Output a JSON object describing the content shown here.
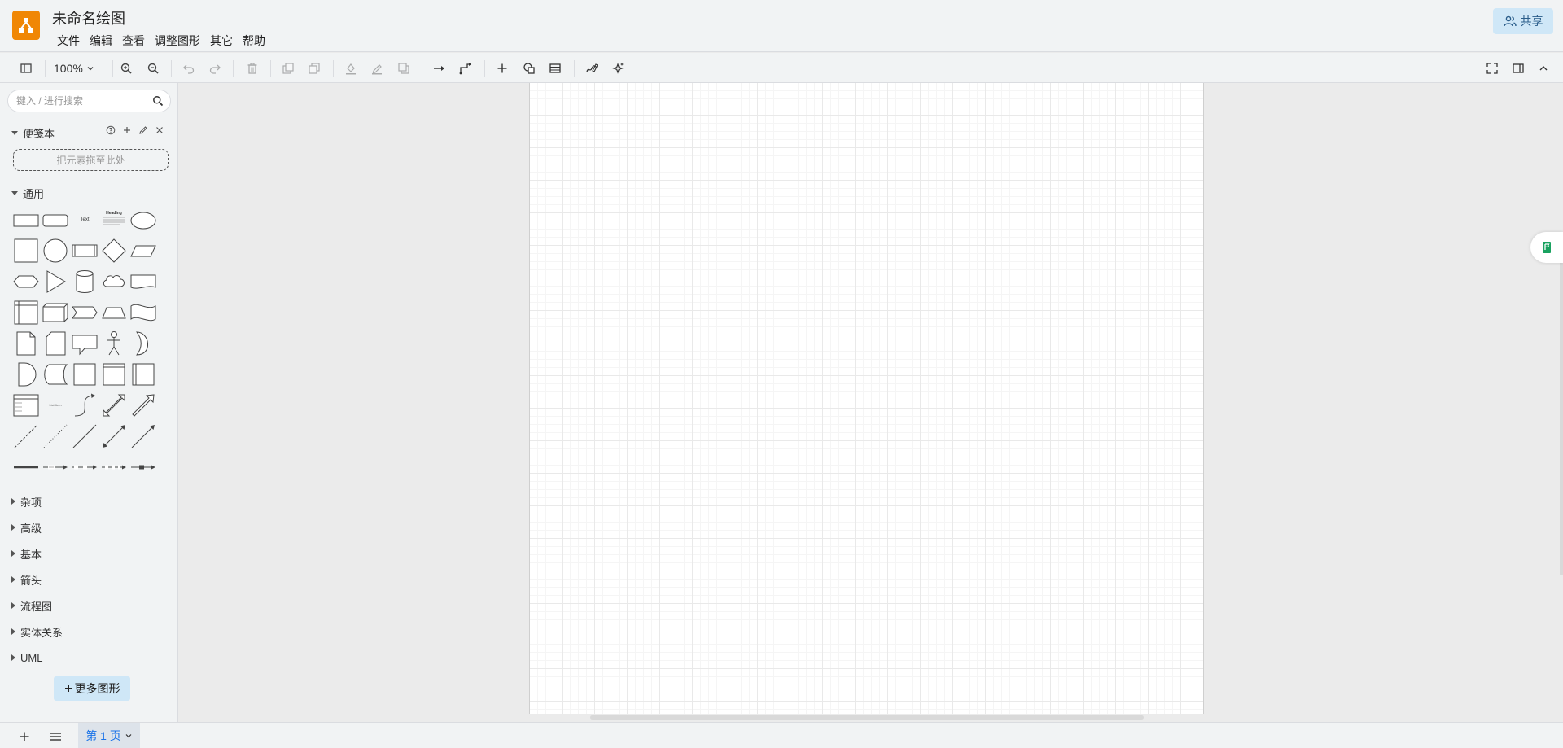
{
  "header": {
    "title": "未命名绘图",
    "menu": [
      "文件",
      "编辑",
      "查看",
      "调整图形",
      "其它",
      "帮助"
    ],
    "share_label": "共享",
    "accent_color": "#f08705"
  },
  "toolbar": {
    "zoom": "100%",
    "icons": [
      "sidebar-toggle-icon",
      "zoom-in-icon",
      "zoom-out-icon",
      "undo-icon",
      "redo-icon",
      "delete-icon",
      "to-front-icon",
      "to-back-icon",
      "fill-color-icon",
      "line-color-icon",
      "shadow-icon",
      "connection-icon",
      "waypoints-icon",
      "insert-icon",
      "shapes-icon",
      "table-icon",
      "freehand-icon",
      "ai-generate-icon",
      "fullscreen-icon",
      "format-panel-icon",
      "collapse-icon"
    ]
  },
  "sidebar": {
    "search_placeholder": "键入 / 进行搜索",
    "scratchpad": {
      "label": "便笺本",
      "drop_hint": "把元素拖至此处"
    },
    "general": {
      "label": "通用",
      "shape_names": [
        "rectangle",
        "rounded-rectangle",
        "text",
        "textbox",
        "ellipse",
        "square",
        "circle",
        "process",
        "diamond",
        "parallelogram",
        "hexagon",
        "triangle",
        "cylinder",
        "cloud",
        "document",
        "internal-storage",
        "cube",
        "step",
        "trapezoid",
        "tape",
        "note",
        "card",
        "callout",
        "actor",
        "or",
        "and",
        "data-storage",
        "rectangle-2",
        "container",
        "vertical-container",
        "list",
        "list-item",
        "curve",
        "bidirectional-arrow",
        "arrow",
        "dashed-line",
        "dotted-line",
        "line",
        "bidirectional-connector",
        "directional-connector",
        "connector",
        "connector-label",
        "connector-labels",
        "connector-label-2",
        "connector-symbol"
      ],
      "text_shape": "Text",
      "textbox_heading": "Heading",
      "list_item_text": "List Item"
    },
    "collapsed_sections": [
      "杂项",
      "高级",
      "基本",
      "箭头",
      "流程图",
      "实体关系",
      "UML"
    ],
    "more_shapes_label": "更多图形"
  },
  "footer": {
    "page_tab_label": "第 1 页"
  }
}
